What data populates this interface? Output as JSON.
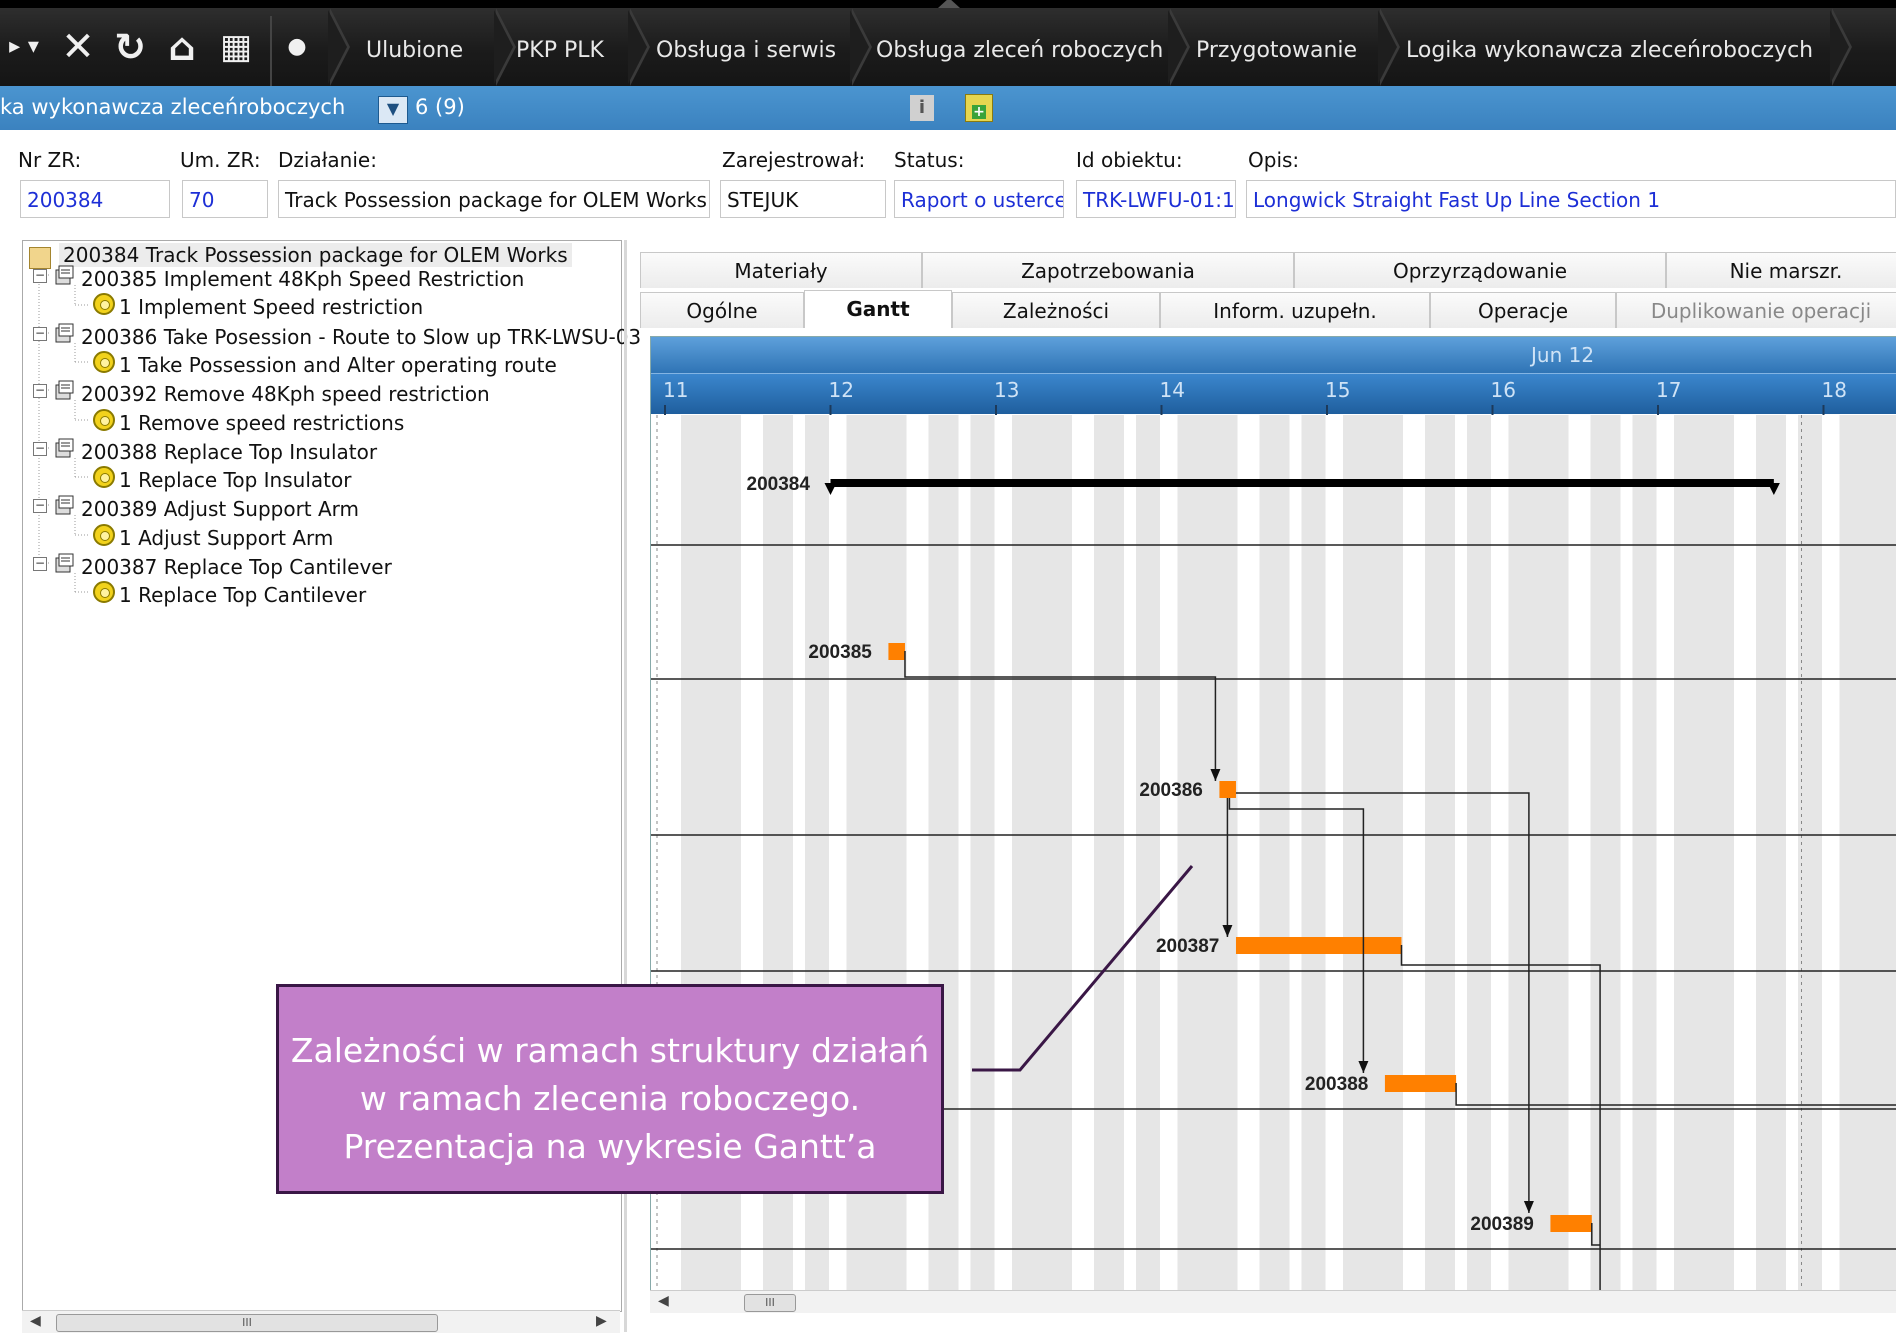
{
  "nav": {
    "breadcrumbs": [
      "Ulubione",
      "PKP PLK",
      "Obsługa i serwis",
      "Obsługa zleceń roboczych",
      "Przygotowanie",
      "Logika wykonawcza zleceńroboczych"
    ],
    "icons": [
      "dropdown-icon",
      "close-icon",
      "refresh-icon",
      "home-icon",
      "grid-icon",
      "dot-icon"
    ]
  },
  "subbar": {
    "title": "ka wykonawcza zleceńroboczych",
    "count": "6 (9)"
  },
  "form": {
    "labels": {
      "nr_zr": "Nr ZR:",
      "um_zr": "Um. ZR:",
      "dzialanie": "Działanie:",
      "zarejestrowal": "Zarejestrował:",
      "status": "Status:",
      "id_obiektu": "Id obiektu:",
      "opis": "Opis:"
    },
    "values": {
      "nr_zr": "200384",
      "um_zr": "70",
      "dzialanie": "Track Possession package for OLEM Works",
      "zarejestrowal": "STEJUK",
      "status": "Raport o usterce",
      "id_obiektu": "TRK-LWFU-01:1",
      "opis": "Longwick Straight Fast Up Line Section 1"
    }
  },
  "tree": {
    "root": "200384  Track Possession package for OLEM Works",
    "items": [
      {
        "wo": "200385  Implement 48Kph Speed Restriction",
        "op": "1  Implement Speed restriction"
      },
      {
        "wo": "200386  Take Posession - Route to Slow up TRK-LWSU-03",
        "op": "1  Take Possession and Alter operating route"
      },
      {
        "wo": "200392  Remove 48Kph speed restriction",
        "op": "1  Remove speed restrictions"
      },
      {
        "wo": "200388  Replace Top Insulator",
        "op": "1  Replace Top Insulator"
      },
      {
        "wo": "200389  Adjust Support Arm",
        "op": "1  Adjust Support Arm"
      },
      {
        "wo": "200387  Replace Top Cantilever",
        "op": "1  Replace Top Cantilever"
      }
    ]
  },
  "tabs": {
    "row1": [
      "Materiały",
      "Zapotrzebowania",
      "Oprzyrządowanie",
      "Nie marszr."
    ],
    "row2": [
      "Ogólne",
      "Gantt",
      "Zależności",
      "Inform. uzupełn.",
      "Operacje",
      "Duplikowanie operacji"
    ],
    "active": "Gantt"
  },
  "gantt": {
    "month_label": "Jun 12",
    "days": [
      "11",
      "12",
      "13",
      "14",
      "15",
      "16",
      "17",
      "18"
    ],
    "summary": {
      "id": "200384",
      "start": 12.0,
      "end": 17.7
    },
    "tasks": [
      {
        "id": "200385",
        "start": 12.35,
        "end": 12.45
      },
      {
        "id": "200386",
        "start": 14.35,
        "end": 14.45
      },
      {
        "id": "200387",
        "start": 14.45,
        "end": 15.45
      },
      {
        "id": "200388",
        "start": 15.35,
        "end": 15.78
      },
      {
        "id": "200389",
        "start": 16.35,
        "end": 16.6
      }
    ],
    "colors": {
      "task": "#ff8000",
      "summary": "#000000",
      "weekend_band": "#e6e6e6"
    }
  },
  "callout": {
    "text_line1": "Zależności w ramach struktury działań",
    "text_line2": "w ramach zlecenia roboczego.",
    "text_line3": "Prezentacja na wykresie Gantt’a"
  },
  "scrollbar": {
    "grip": "III"
  }
}
